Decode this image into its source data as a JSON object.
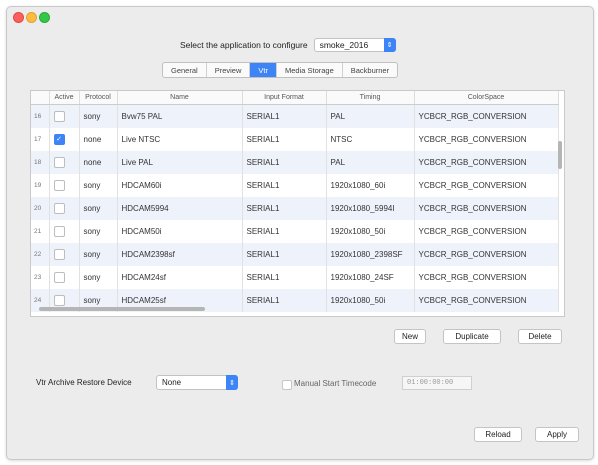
{
  "app": {
    "select_label": "Select the application to configure",
    "selected_app": "smoke_2016"
  },
  "tabs": [
    {
      "label": "General",
      "active": false
    },
    {
      "label": "Preview",
      "active": false
    },
    {
      "label": "Vtr",
      "active": true
    },
    {
      "label": "Media Storage",
      "active": false
    },
    {
      "label": "Backburner",
      "active": false
    }
  ],
  "table": {
    "columns": [
      "",
      "Active",
      "Protocol",
      "Name",
      "Input Format",
      "Timing",
      "ColorSpace"
    ],
    "rows": [
      {
        "num": "16",
        "active": false,
        "protocol": "sony",
        "name": "Bvw75 PAL",
        "input": "SERIAL1",
        "timing": "PAL",
        "colorspace": "YCBCR_RGB_CONVERSION"
      },
      {
        "num": "17",
        "active": true,
        "protocol": "none",
        "name": "Live NTSC",
        "input": "SERIAL1",
        "timing": "NTSC",
        "colorspace": "YCBCR_RGB_CONVERSION"
      },
      {
        "num": "18",
        "active": false,
        "protocol": "none",
        "name": "Live PAL",
        "input": "SERIAL1",
        "timing": "PAL",
        "colorspace": "YCBCR_RGB_CONVERSION"
      },
      {
        "num": "19",
        "active": false,
        "protocol": "sony",
        "name": "HDCAM60i",
        "input": "SERIAL1",
        "timing": "1920x1080_60i",
        "colorspace": "YCBCR_RGB_CONVERSION"
      },
      {
        "num": "20",
        "active": false,
        "protocol": "sony",
        "name": "HDCAM5994",
        "input": "SERIAL1",
        "timing": "1920x1080_5994I",
        "colorspace": "YCBCR_RGB_CONVERSION"
      },
      {
        "num": "21",
        "active": false,
        "protocol": "sony",
        "name": "HDCAM50i",
        "input": "SERIAL1",
        "timing": "1920x1080_50i",
        "colorspace": "YCBCR_RGB_CONVERSION"
      },
      {
        "num": "22",
        "active": false,
        "protocol": "sony",
        "name": "HDCAM2398sf",
        "input": "SERIAL1",
        "timing": "1920x1080_2398SF",
        "colorspace": "YCBCR_RGB_CONVERSION"
      },
      {
        "num": "23",
        "active": false,
        "protocol": "sony",
        "name": "HDCAM24sf",
        "input": "SERIAL1",
        "timing": "1920x1080_24SF",
        "colorspace": "YCBCR_RGB_CONVERSION"
      },
      {
        "num": "24",
        "active": false,
        "protocol": "sony",
        "name": "HDCAM25sf",
        "input": "SERIAL1",
        "timing": "1920x1080_50i",
        "colorspace": "YCBCR_RGB_CONVERSION"
      }
    ]
  },
  "table_buttons": {
    "new": "New",
    "duplicate": "Duplicate",
    "delete": "Delete"
  },
  "archive": {
    "label": "Vtr Archive Restore Device",
    "value": "None"
  },
  "timecode": {
    "label": "Manual Start Timecode",
    "value": "01:00:00:00"
  },
  "footer": {
    "reload": "Reload",
    "apply": "Apply"
  },
  "colors": {
    "accent": "#3d84f7",
    "row_alt": "#eef2fb"
  }
}
